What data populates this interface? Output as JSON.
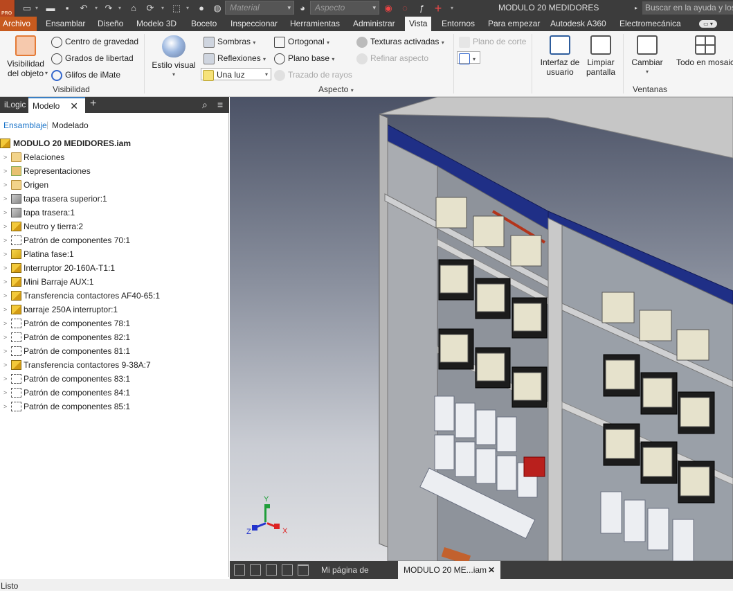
{
  "app": {
    "title": "MODULO 20 MEDIDORES",
    "logo_badge": "PRO",
    "material_placeholder": "Material",
    "appearance_placeholder": "Aspecto",
    "help_search": "Buscar en la ayuda y los"
  },
  "ribbon_tabs": [
    {
      "label": "Archivo"
    },
    {
      "label": "Ensamblar"
    },
    {
      "label": "Diseño"
    },
    {
      "label": "Modelo 3D"
    },
    {
      "label": "Boceto"
    },
    {
      "label": "Inspeccionar"
    },
    {
      "label": "Herramientas"
    },
    {
      "label": "Administrar"
    },
    {
      "label": "Vista"
    },
    {
      "label": "Entornos"
    },
    {
      "label": "Para empezar"
    },
    {
      "label": "Autodesk A360"
    },
    {
      "label": "Electromecánica"
    }
  ],
  "ribbon": {
    "visibility": {
      "object_visibility_1": "Visibilidad",
      "object_visibility_2": "del objeto",
      "center_of_gravity": "Centro de gravedad",
      "degrees_of_freedom": "Grados de libertad",
      "imate_glyphs": "Glifos de iMate",
      "group_label": "Visibilidad"
    },
    "appearance": {
      "visual_style_1": "Estilo visual",
      "shadows": "Sombras",
      "reflections": "Reflexiones",
      "lighting": "Una luz",
      "orthographic": "Ortogonal",
      "ground_plane": "Plano base",
      "ray_tracing": "Trazado de rayos",
      "textures": "Texturas activadas",
      "refine_appearance": "Refinar aspecto",
      "section_plane": "Plano de corte",
      "group_label": "Aspecto"
    },
    "windows": {
      "ui_1": "Interfaz de",
      "ui_2": "usuario",
      "clean_1": "Limpiar",
      "clean_2": "pantalla",
      "switch": "Cambiar",
      "tile_all": "Todo en mosaic",
      "group_label": "Ventanas"
    }
  },
  "panel": {
    "tabs": [
      "iLogic",
      "Modelo"
    ],
    "sub_assembly": "Ensamblaje",
    "sub_modeling": "Modelado",
    "root": "MODULO 20 MEDIDORES.iam",
    "items": [
      {
        "label": "Relaciones",
        "icon": "folder-icon"
      },
      {
        "label": "Representaciones",
        "icon": "representations-icon"
      },
      {
        "label": "Origen",
        "icon": "folder-icon"
      },
      {
        "label": "tapa trasera superior:1",
        "icon": "sheet-part-icon"
      },
      {
        "label": "tapa trasera:1",
        "icon": "part-gray-icon"
      },
      {
        "label": "Neutro y tierra:2",
        "icon": "assembly-icon"
      },
      {
        "label": "Patrón de componentes 70:1",
        "icon": "pattern-icon"
      },
      {
        "label": "Platina fase:1",
        "icon": "part-icon"
      },
      {
        "label": "Interruptor 20-160A-T1:1",
        "icon": "assembly-icon"
      },
      {
        "label": "Mini Barraje AUX:1",
        "icon": "assembly-icon"
      },
      {
        "label": "Transferencia contactores AF40-65:1",
        "icon": "assembly-icon"
      },
      {
        "label": "barraje 250A interruptor:1",
        "icon": "assembly-icon"
      },
      {
        "label": "Patrón de componentes 78:1",
        "icon": "pattern-icon"
      },
      {
        "label": "Patrón de componentes 82:1",
        "icon": "pattern-icon"
      },
      {
        "label": "Patrón de componentes 81:1",
        "icon": "pattern-icon"
      },
      {
        "label": "Transferencia contactores 9-38A:7",
        "icon": "assembly-icon"
      },
      {
        "label": "Patrón de componentes 83:1",
        "icon": "pattern-icon"
      },
      {
        "label": "Patrón de componentes 84:1",
        "icon": "pattern-icon"
      },
      {
        "label": "Patrón de componentes 85:1",
        "icon": "pattern-icon"
      }
    ]
  },
  "viewport": {
    "axis_x": "X",
    "axis_y": "Y",
    "axis_z": "Z"
  },
  "doc_tabs": [
    {
      "label": "Mi página de inic..."
    },
    {
      "label": "MODULO 20 ME...iam"
    }
  ],
  "status": "Listo",
  "colors": {
    "file_tab": "#c75a1e",
    "dark_chrome": "#3c3c3c",
    "accent_blue": "#1a5bb5",
    "header_blue_band": "#1d2f8a"
  }
}
